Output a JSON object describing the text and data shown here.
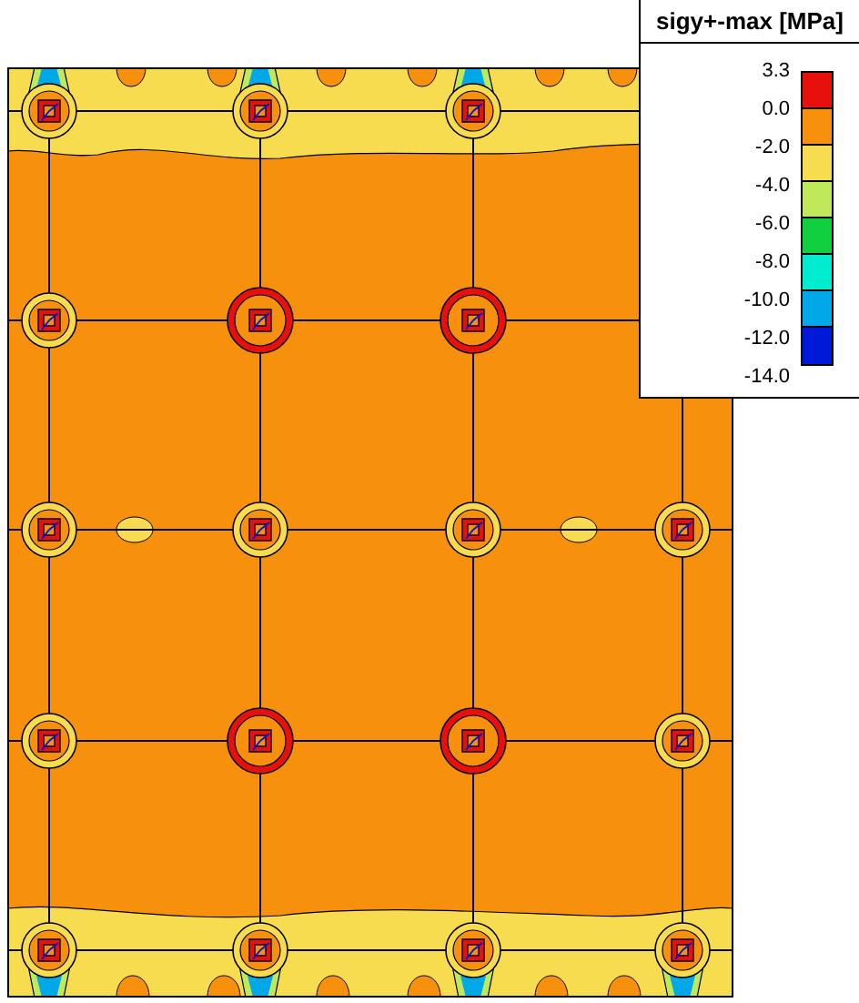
{
  "legend": {
    "title": "sigy+-max [MPa]",
    "ticks": [
      "3.3",
      "0.0",
      "-2.0",
      "-4.0",
      "-6.0",
      "-8.0",
      "-10.0",
      "-12.0",
      "-14.0"
    ],
    "bands": [
      {
        "color": "#e8100c"
      },
      {
        "color": "#f7900c"
      },
      {
        "color": "#f8dc50"
      },
      {
        "color": "#bfe85a"
      },
      {
        "color": "#10d040"
      },
      {
        "color": "#00ecd0"
      },
      {
        "color": "#00a8e8"
      },
      {
        "color": "#0018d8"
      }
    ]
  }
}
